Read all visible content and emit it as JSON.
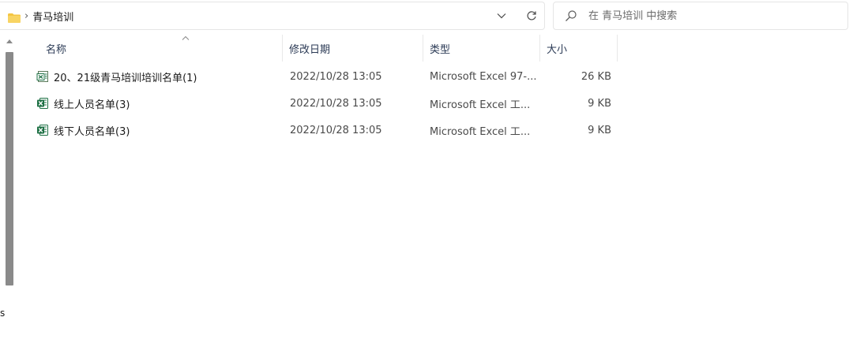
{
  "address_bar": {
    "separator": "›",
    "crumb": "青马培训"
  },
  "search": {
    "placeholder": "在 青马培训 中搜索"
  },
  "nav": {
    "cut_text": "s"
  },
  "columns": {
    "name": "名称",
    "date": "修改日期",
    "type": "类型",
    "size": "大小"
  },
  "files": [
    {
      "name": "20、21级青马培训培训名单(1)",
      "date": "2022/10/28 13:05",
      "type": "Microsoft Excel 97-...",
      "size": "26 KB",
      "icon": "excel-legacy-icon"
    },
    {
      "name": "线上人员名单(3)",
      "date": "2022/10/28 13:05",
      "type": "Microsoft Excel 工...",
      "size": "9 KB",
      "icon": "excel-icon"
    },
    {
      "name": "线下人员名单(3)",
      "date": "2022/10/28 13:05",
      "type": "Microsoft Excel 工...",
      "size": "9 KB",
      "icon": "excel-icon"
    }
  ],
  "colors": {
    "folder": "#f4c542",
    "excel_green": "#1d7044",
    "header_text": "#2b3a55"
  }
}
